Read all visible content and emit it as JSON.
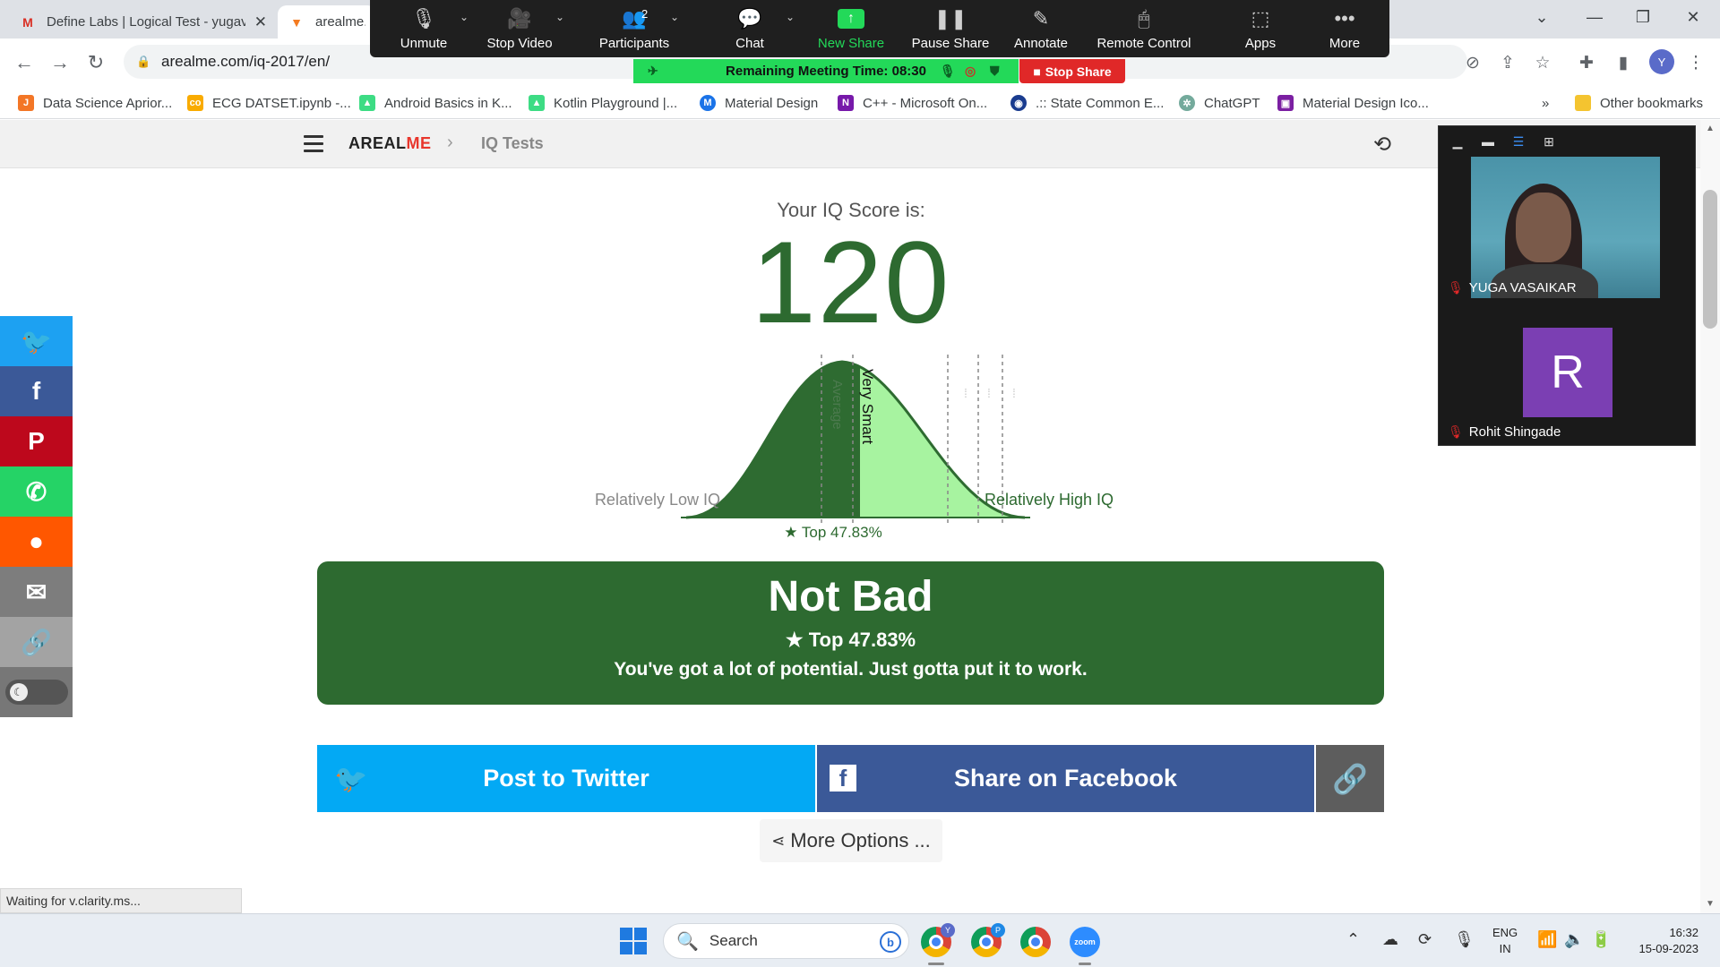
{
  "browser": {
    "tabs": [
      {
        "title": "Define Labs | Logical Test - yugav",
        "icon": "gmail-icon"
      },
      {
        "title": "arealme.c",
        "icon": "fox-icon"
      }
    ],
    "url": "arealme.com/iq-2017/en/",
    "profile_initial": "Y",
    "status_text": "Waiting for v.clarity.ms...",
    "bookmarks": [
      {
        "label": "Data Science Aprior...",
        "icon": "jupyter-icon",
        "color": "#f37626"
      },
      {
        "label": "ECG DATSET.ipynb -...",
        "icon": "colab-icon",
        "color": "#f9ab00"
      },
      {
        "label": "Android Basics in K...",
        "icon": "android-icon",
        "color": "#3ddc84"
      },
      {
        "label": "Kotlin Playground |...",
        "icon": "android-icon",
        "color": "#3ddc84"
      },
      {
        "label": "Material Design",
        "icon": "material-icon",
        "color": "#1a73e8"
      },
      {
        "label": "C++ - Microsoft On...",
        "icon": "onenote-icon",
        "color": "#7719aa"
      },
      {
        "label": ".:: State Common E...",
        "icon": "globe-icon",
        "color": "#1a3c8f"
      },
      {
        "label": "ChatGPT",
        "icon": "chatgpt-icon",
        "color": "#74aa9c"
      },
      {
        "label": "Material Design Ico...",
        "icon": "mdi-icon",
        "color": "#7b1fa2"
      }
    ],
    "bookmarks_overflow": "»",
    "other_bookmarks": "Other bookmarks"
  },
  "zoom": {
    "toolbar": [
      {
        "label": "Unmute",
        "icon": "mic-muted-icon"
      },
      {
        "label": "Stop Video",
        "icon": "video-camera-icon"
      },
      {
        "label": "Participants",
        "icon": "participants-icon"
      },
      {
        "label": "Chat",
        "icon": "chat-icon"
      },
      {
        "label": "New Share",
        "icon": "share-arrow-icon"
      },
      {
        "label": "Pause Share",
        "icon": "pause-icon"
      },
      {
        "label": "Annotate",
        "icon": "pencil-icon"
      },
      {
        "label": "Remote Control",
        "icon": "mouse-icon"
      },
      {
        "label": "Apps",
        "icon": "apps-icon"
      },
      {
        "label": "More",
        "icon": "more-dots-icon"
      }
    ],
    "participant_count": "2",
    "remaining_time": "Remaining Meeting Time: 08:30",
    "stop_share": "Stop Share",
    "accent": "#23d959",
    "participants": [
      {
        "name": "YUGA VASAIKAR"
      },
      {
        "name": "Rohit Shingade",
        "initial": "R"
      }
    ]
  },
  "site": {
    "logo_main": "AREAL",
    "logo_accent": "ME",
    "breadcrumb": "IQ Tests",
    "brand_green": "#2d6a30"
  },
  "result": {
    "score_label": "Your IQ Score is:",
    "score": "120",
    "curve_labels": {
      "average": "Average",
      "very_smart": "Very Smart"
    },
    "low_label": "Relatively Low IQ",
    "high_label": "Relatively High IQ",
    "top_marker": "★ Top 47.83%",
    "title": "Not Bad",
    "top_percent": "★ Top 47.83%",
    "message": "You've got a lot of potential. Just gotta put it to work.",
    "btn_twitter": "Post to Twitter",
    "btn_facebook": "Share on Facebook",
    "more_options": "More Options ..."
  },
  "share_sidebar": [
    {
      "name": "twitter",
      "color": "#1da1f2"
    },
    {
      "name": "facebook",
      "color": "#3b5998"
    },
    {
      "name": "pinterest",
      "color": "#bd081c"
    },
    {
      "name": "whatsapp",
      "color": "#25d366"
    },
    {
      "name": "reddit",
      "color": "#ff5700"
    },
    {
      "name": "email",
      "color": "#7d7d7d"
    },
    {
      "name": "link",
      "color": "#a3a3a3"
    }
  ],
  "taskbar": {
    "search": "Search",
    "lang_line1": "ENG",
    "lang_line2": "IN",
    "time": "16:32",
    "date": "15-09-2023"
  }
}
